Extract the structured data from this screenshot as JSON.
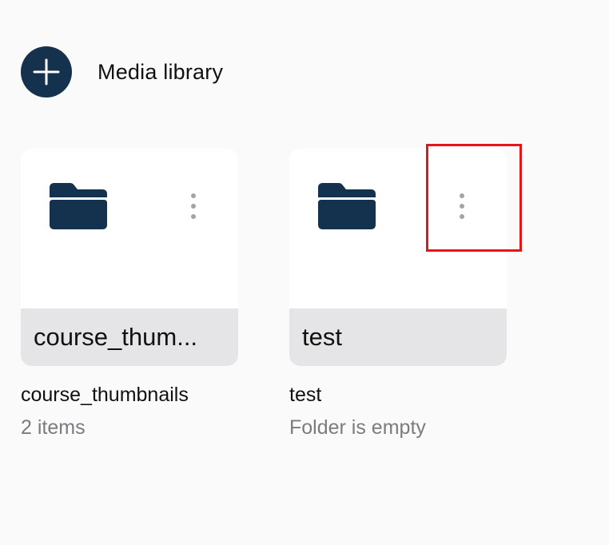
{
  "header": {
    "title": "Media library",
    "add_icon": "plus-icon"
  },
  "folders": [
    {
      "tile_label": "course_thum...",
      "name": "course_thumbnails",
      "meta": "2 items",
      "icon": "folder-icon",
      "menu_icon": "vertical-ellipsis-icon"
    },
    {
      "tile_label": "test",
      "name": "test",
      "meta": "Folder is empty",
      "icon": "folder-icon",
      "menu_icon": "vertical-ellipsis-icon"
    }
  ],
  "colors": {
    "primary": "#14314d",
    "background": "#fafafa",
    "tile": "#ffffff",
    "tile_footer": "#e5e5e7",
    "muted_text": "#7b7b80",
    "highlight": "#e8141c"
  }
}
